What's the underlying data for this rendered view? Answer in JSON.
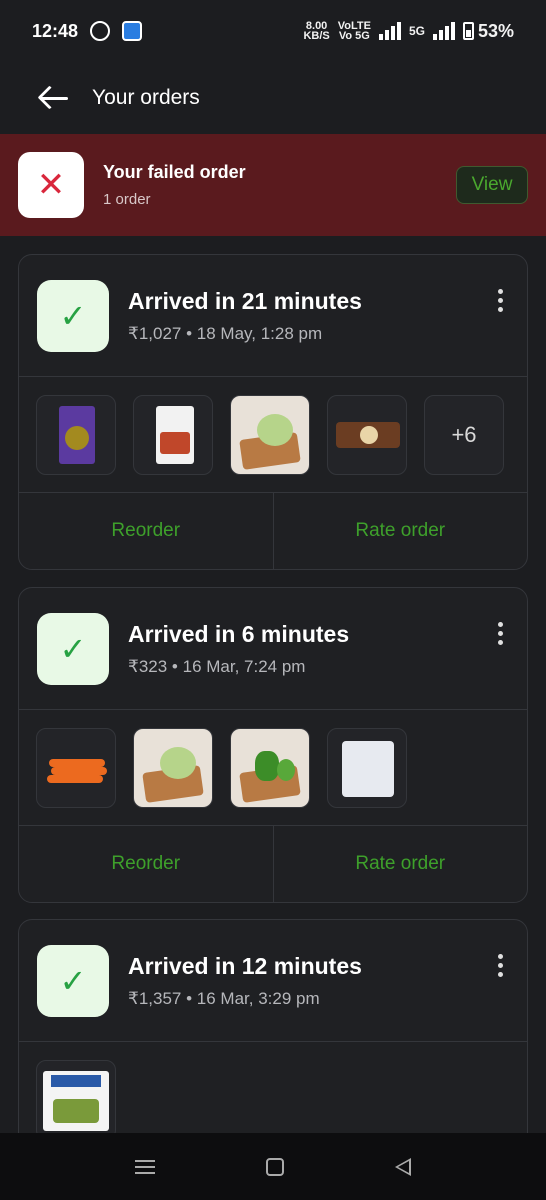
{
  "status_bar": {
    "time": "12:48",
    "speed_value": "8.00",
    "speed_unit": "KB/S",
    "network_label_1": "VoLTE",
    "network_label_2": "Vo 5G",
    "network_type": "5G",
    "battery": "53%"
  },
  "header": {
    "title": "Your orders"
  },
  "failed_banner": {
    "title": "Your failed order",
    "subtitle": "1 order",
    "view_label": "View"
  },
  "orders": [
    {
      "status": "Arrived in 21 minutes",
      "amount": "₹1,027",
      "date": "18 May, 1:28 pm",
      "items": [
        "green-gram-pack",
        "sambar-powder-pack",
        "cabbage",
        "chocolate-bar"
      ],
      "more_count": "+6",
      "reorder_label": "Reorder",
      "rate_label": "Rate order"
    },
    {
      "status": "Arrived in 6 minutes",
      "amount": "₹323",
      "date": "16 Mar, 7:24 pm",
      "items": [
        "carrots",
        "cabbage",
        "capsicum",
        "egg-tray"
      ],
      "reorder_label": "Reorder",
      "rate_label": "Rate order"
    },
    {
      "status": "Arrived in 12 minutes",
      "amount": "₹1,357",
      "date": "16 Mar, 3:29 pm",
      "items": [
        "milk-pack"
      ]
    }
  ],
  "colors": {
    "background": "#1c1d20",
    "failed_banner": "#5a1a1e",
    "accent_green": "#3ea02b",
    "error_red": "#d9273c"
  }
}
